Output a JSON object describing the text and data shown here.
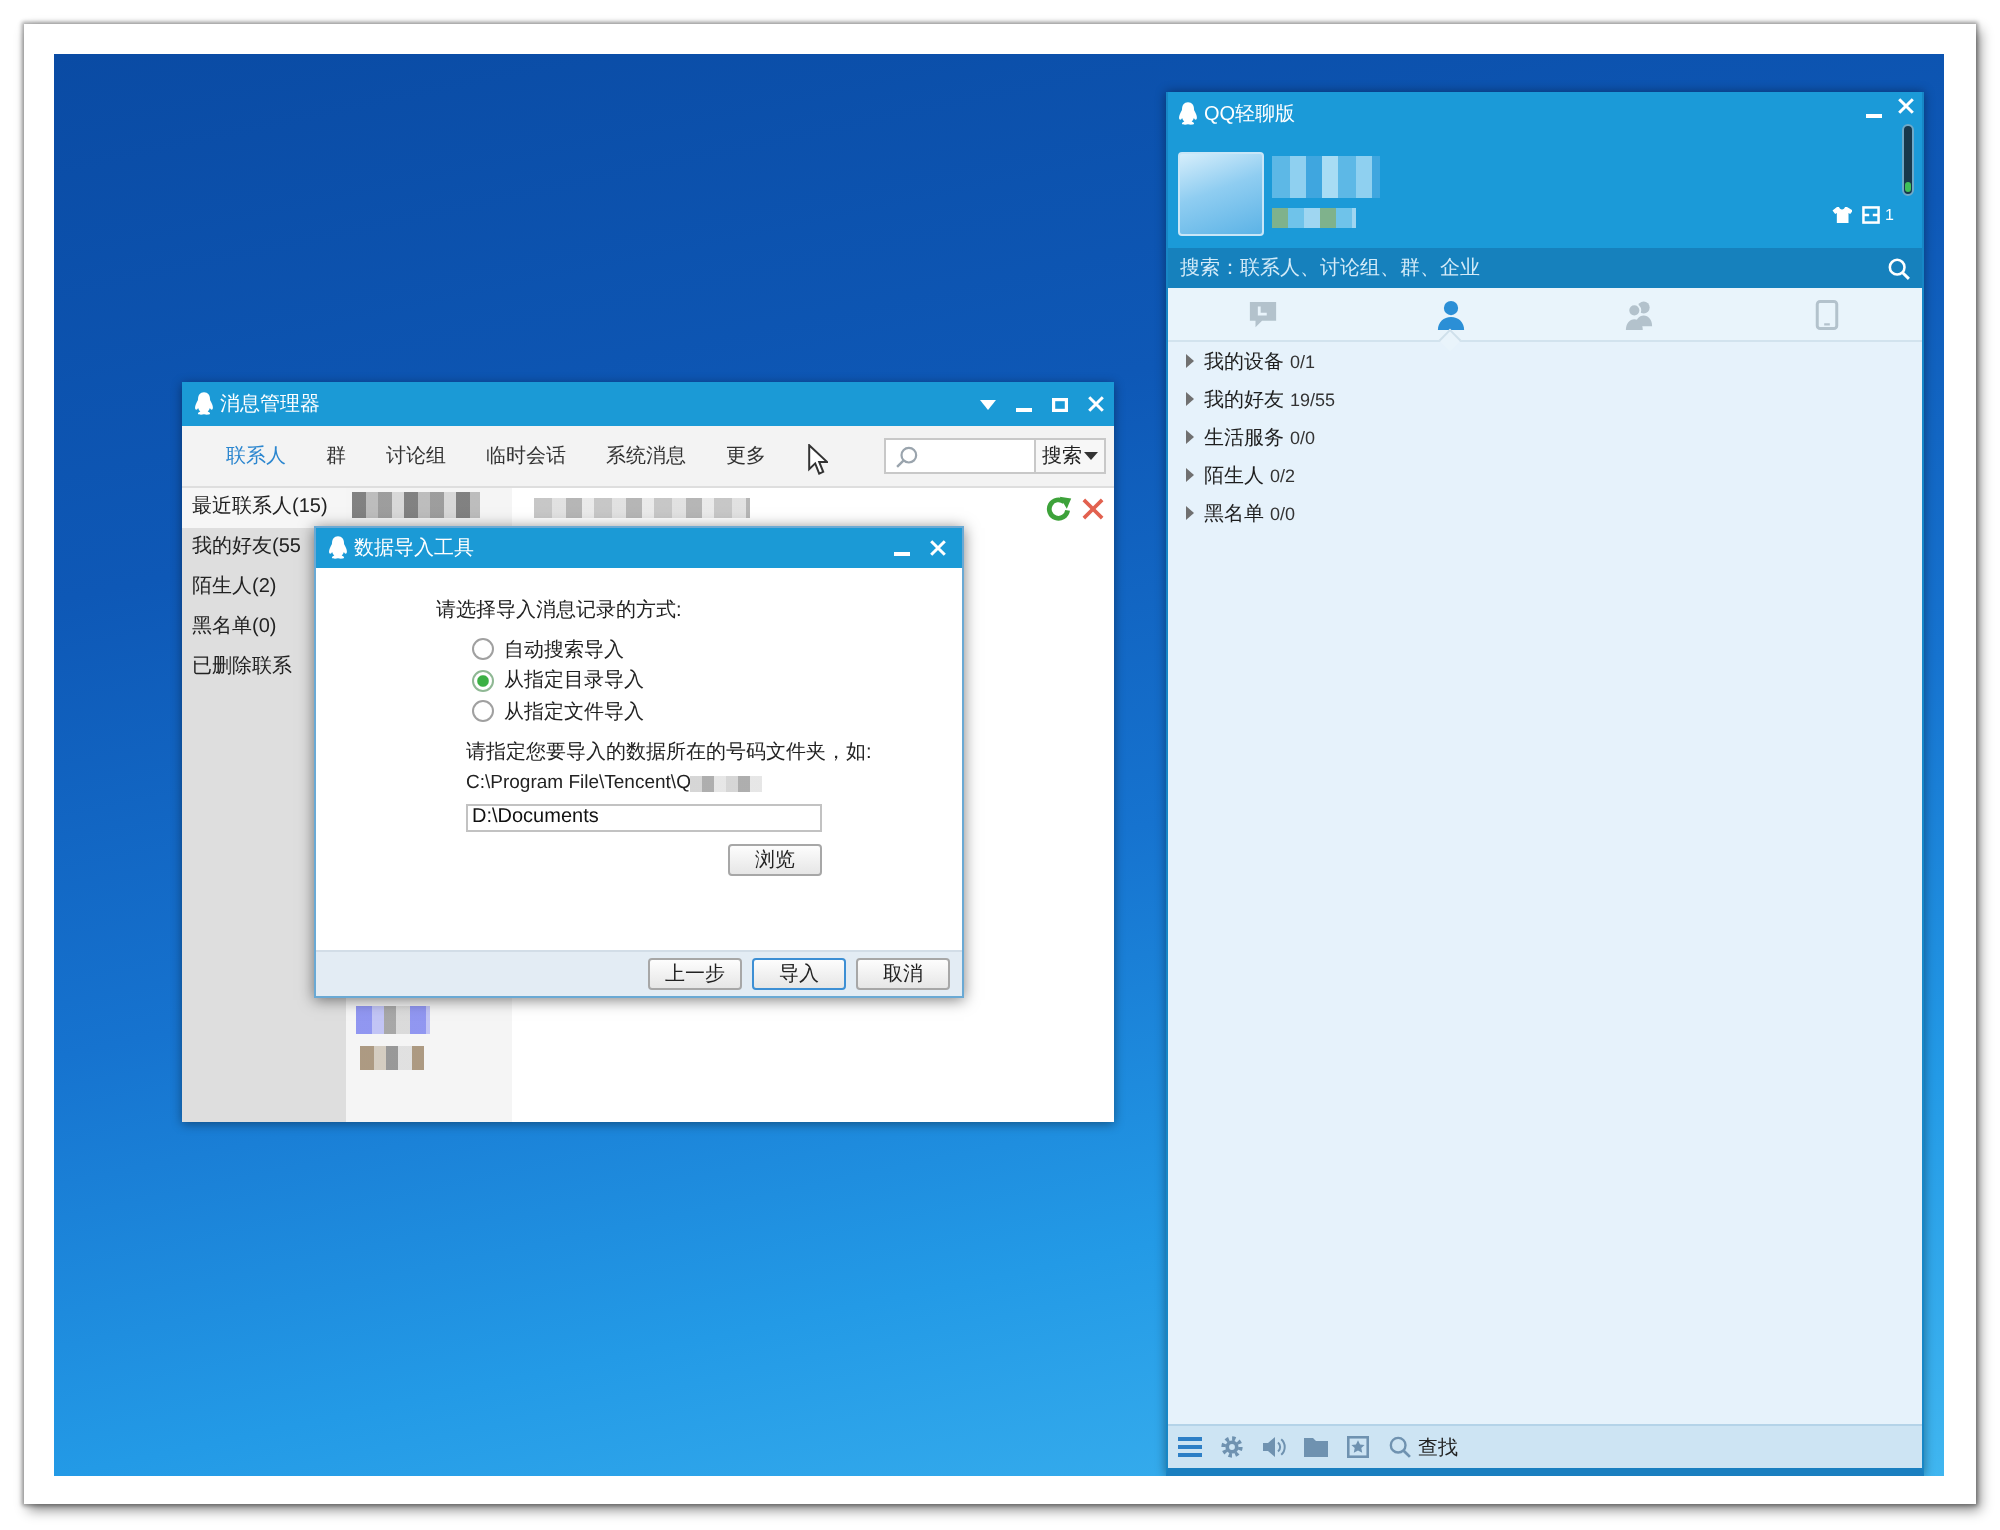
{
  "message_manager": {
    "title": "消息管理器",
    "tabs": [
      {
        "label": "联系人",
        "selected": true
      },
      {
        "label": "群",
        "selected": false
      },
      {
        "label": "讨论组",
        "selected": false
      },
      {
        "label": "临时会话",
        "selected": false
      },
      {
        "label": "系统消息",
        "selected": false
      },
      {
        "label": "更多",
        "selected": false
      }
    ],
    "search_button": "搜索",
    "sidebar": [
      {
        "label": "最近联系人(15)",
        "selected": true
      },
      {
        "label": "我的好友(55",
        "selected": false
      },
      {
        "label": "陌生人(2)",
        "selected": false
      },
      {
        "label": "黑名单(0)",
        "selected": false
      },
      {
        "label": "已删除联系",
        "selected": false
      }
    ]
  },
  "import_dialog": {
    "title": "数据导入工具",
    "prompt": "请选择导入消息记录的方式:",
    "options": [
      {
        "label": "自动搜索导入",
        "selected": false
      },
      {
        "label": "从指定目录导入",
        "selected": true
      },
      {
        "label": "从指定文件导入",
        "selected": false
      }
    ],
    "folder_prompt": "请指定您要导入的数据所在的号码文件夹，如:",
    "example_path": "C:\\Program File\\Tencent\\Q",
    "path_value": "D:\\Documents",
    "browse_button": "浏览",
    "buttons": [
      {
        "label": "上一步",
        "default": false
      },
      {
        "label": "导入",
        "default": true
      },
      {
        "label": "取消",
        "default": false
      }
    ]
  },
  "qq_panel": {
    "title": "QQ轻聊版",
    "badge": "1",
    "search": {
      "placeholder": "搜索：联系人、讨论组、群、企业"
    },
    "tabs": [
      {
        "kind": "chats",
        "selected": false
      },
      {
        "kind": "contacts",
        "selected": true
      },
      {
        "kind": "groups",
        "selected": false
      },
      {
        "kind": "devices",
        "selected": false
      }
    ],
    "groups": [
      {
        "name": "我的设备",
        "count": "0/1"
      },
      {
        "name": "我的好友",
        "count": "19/55"
      },
      {
        "name": "生活服务",
        "count": "0/0"
      },
      {
        "name": "陌生人",
        "count": "0/2"
      },
      {
        "name": "黑名单",
        "count": "0/0"
      }
    ],
    "toolbar": {
      "find_label": "查找"
    }
  }
}
